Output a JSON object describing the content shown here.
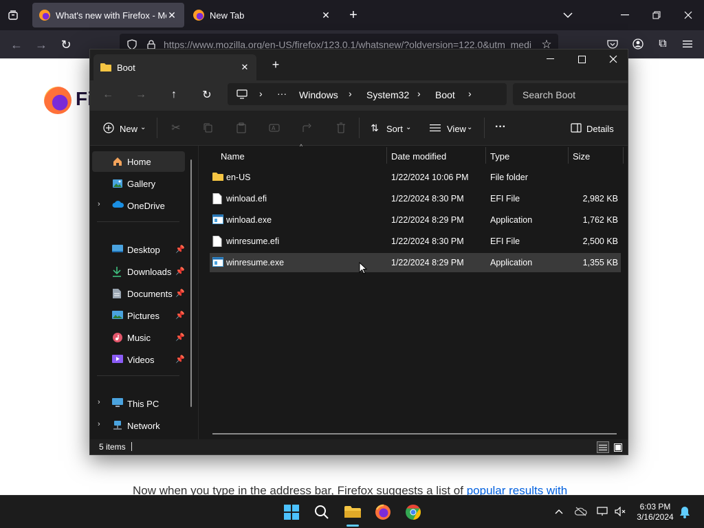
{
  "browser": {
    "tabs": [
      {
        "label": "What's new with Firefox - More",
        "active": true
      },
      {
        "label": "New Tab",
        "active": false
      }
    ],
    "url": "https://www.mozilla.org/en-US/firefox/123.0.1/whatsnew/?oldversion=122.0&utm_medi",
    "page": {
      "logo_text": "Fi",
      "body_text": "Now when you type in the address bar, Firefox suggests a list of ",
      "body_link": "popular results with"
    }
  },
  "explorer": {
    "tab_title": "Boot",
    "breadcrumb": [
      "Windows",
      "System32",
      "Boot"
    ],
    "breadcrumb_more": "···",
    "search_placeholder": "Search Boot",
    "commands": {
      "new": "New",
      "sort": "Sort",
      "view": "View",
      "more": "···",
      "details": "Details"
    },
    "nav": [
      {
        "label": "Home",
        "icon": "home-icon",
        "selected": true
      },
      {
        "label": "Gallery",
        "icon": "gallery-icon"
      },
      {
        "label": "OneDrive",
        "icon": "onedrive-icon",
        "expandable": true
      },
      {
        "label": "Desktop",
        "icon": "desktop-icon",
        "pinned": true
      },
      {
        "label": "Downloads",
        "icon": "downloads-icon",
        "pinned": true
      },
      {
        "label": "Documents",
        "icon": "documents-icon",
        "pinned": true
      },
      {
        "label": "Pictures",
        "icon": "pictures-icon",
        "pinned": true
      },
      {
        "label": "Music",
        "icon": "music-icon",
        "pinned": true
      },
      {
        "label": "Videos",
        "icon": "videos-icon",
        "pinned": true
      },
      {
        "label": "This PC",
        "icon": "this-pc-icon",
        "expandable": true
      },
      {
        "label": "Network",
        "icon": "network-icon",
        "expandable": true
      }
    ],
    "columns": [
      "Name",
      "Date modified",
      "Type",
      "Size"
    ],
    "files": [
      {
        "name": "en-US",
        "date": "1/22/2024 10:06 PM",
        "type": "File folder",
        "size": "",
        "icon": "folder-icon"
      },
      {
        "name": "winload.efi",
        "date": "1/22/2024 8:30 PM",
        "type": "EFI File",
        "size": "2,982 KB",
        "icon": "file-icon"
      },
      {
        "name": "winload.exe",
        "date": "1/22/2024 8:29 PM",
        "type": "Application",
        "size": "1,762 KB",
        "icon": "exe-icon"
      },
      {
        "name": "winresume.efi",
        "date": "1/22/2024 8:30 PM",
        "type": "EFI File",
        "size": "2,500 KB",
        "icon": "file-icon"
      },
      {
        "name": "winresume.exe",
        "date": "1/22/2024 8:29 PM",
        "type": "Application",
        "size": "1,355 KB",
        "icon": "exe-icon",
        "selected": true
      }
    ],
    "status": "5 items"
  },
  "taskbar": {
    "time": "6:03 PM",
    "date": "3/16/2024"
  },
  "colors": {
    "accent": "#60cdff",
    "folder": "#f5c543",
    "selection": "#3a3a3a"
  }
}
